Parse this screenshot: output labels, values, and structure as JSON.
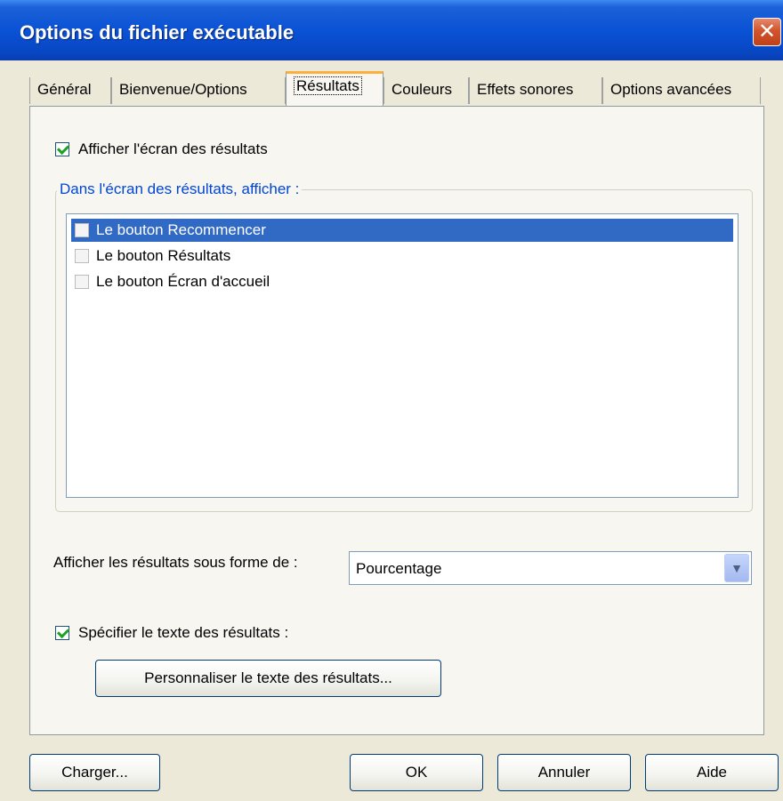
{
  "window": {
    "title": "Options du fichier exécutable",
    "close_glyph": "✕"
  },
  "tabs": [
    {
      "label": "Général"
    },
    {
      "label": "Bienvenue/Options"
    },
    {
      "label": "Résultats",
      "active": true
    },
    {
      "label": "Couleurs"
    },
    {
      "label": "Effets sonores"
    },
    {
      "label": "Options avancées"
    }
  ],
  "results_tab": {
    "show_results_screen": {
      "label": "Afficher l'écran des résultats",
      "checked": true
    },
    "group_title": "Dans l'écran des résultats, afficher :",
    "list_items": [
      {
        "label": "Le bouton Recommencer",
        "checked": false,
        "selected": true
      },
      {
        "label": "Le bouton Résultats",
        "checked": false,
        "selected": false
      },
      {
        "label": "Le bouton Écran d'accueil",
        "checked": false,
        "selected": false
      }
    ],
    "display_as": {
      "label": "Afficher les résultats sous forme de :",
      "value": "Pourcentage",
      "arrow_icon": "chevron-down-icon"
    },
    "specify_text": {
      "label": "Spécifier le texte des résultats :",
      "checked": true
    },
    "customize_button": "Personnaliser le texte des résultats..."
  },
  "footer": {
    "load": "Charger...",
    "ok": "OK",
    "cancel": "Annuler",
    "help": "Aide"
  },
  "colors": {
    "titlebar": "#0a52d6",
    "selection": "#316ac5",
    "group_title": "#0046d5",
    "check": "#21a121",
    "active_tab_accent": "#fcaf3c"
  }
}
